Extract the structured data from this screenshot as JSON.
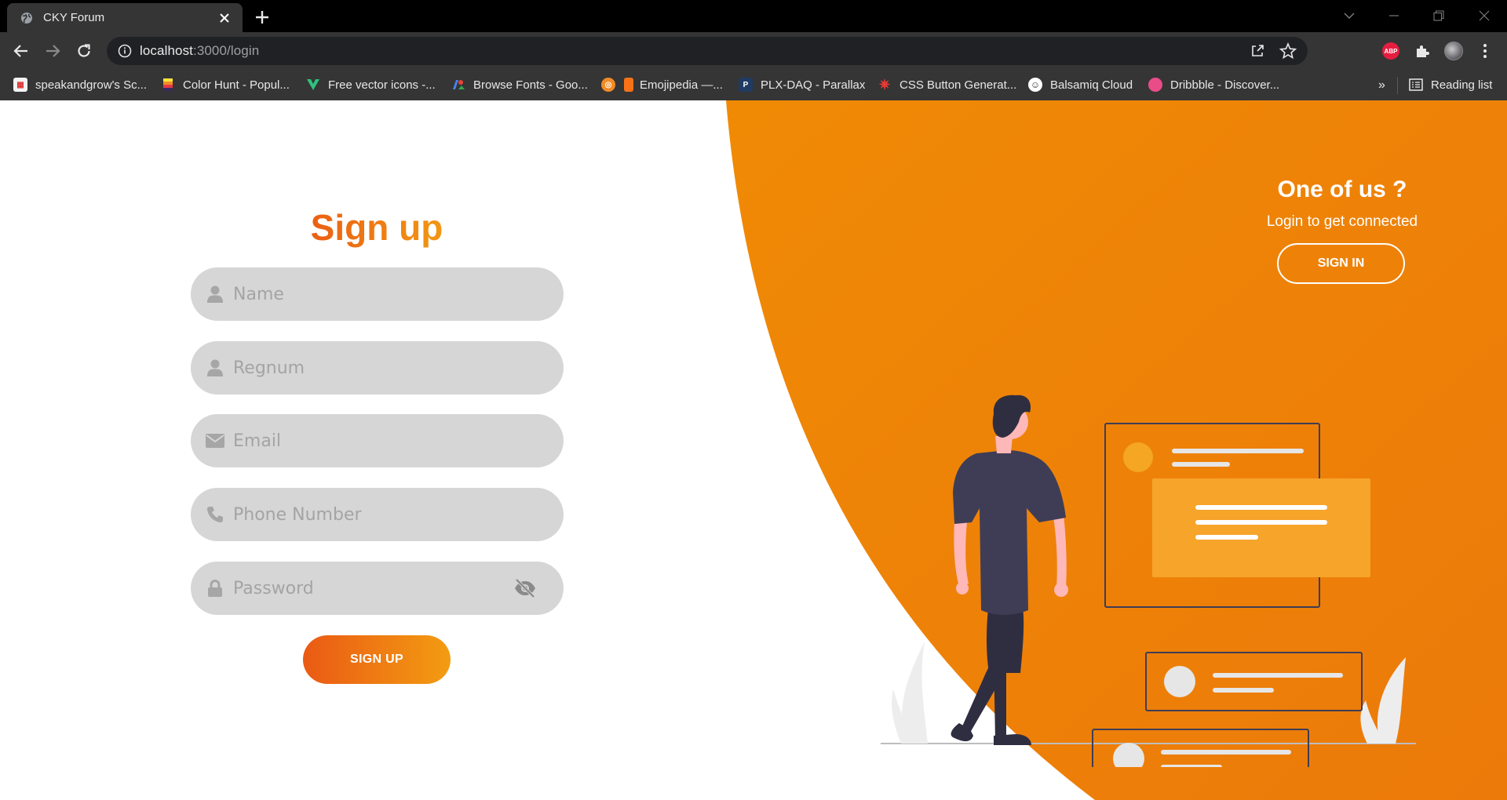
{
  "browser": {
    "tab_title": "CKY Forum",
    "url_host": "localhost",
    "url_rest": ":3000/login",
    "bookmarks": [
      {
        "label": "speakandgrow's Sc...",
        "color": "#f3f3f3"
      },
      {
        "label": "Color Hunt - Popul...",
        "color": "#f0c419"
      },
      {
        "label": "Free vector icons -...",
        "color": "#2ec27e"
      },
      {
        "label": "Browse Fonts - Goo...",
        "color": "#4285f4"
      },
      {
        "label": "",
        "color": "#f28b25"
      },
      {
        "label": "Emojipedia —...",
        "color": "#f97316"
      },
      {
        "label": "PLX-DAQ - Parallax",
        "color": "#1f3b63"
      },
      {
        "label": "CSS Button Generat...",
        "color": "#e53935"
      },
      {
        "label": "Balsamiq Cloud",
        "color": "#ffffff"
      },
      {
        "label": "Dribbble - Discover...",
        "color": "#ea4c89"
      }
    ],
    "more_label": "»",
    "reading_list": "Reading list",
    "extension_abp": "ABP"
  },
  "signup": {
    "title": "Sign up",
    "fields": [
      {
        "icon": "user-icon",
        "placeholder": "Name"
      },
      {
        "icon": "user-icon",
        "placeholder": "Regnum"
      },
      {
        "icon": "envelope-icon",
        "placeholder": "Email"
      },
      {
        "icon": "phone-icon",
        "placeholder": "Phone Number"
      },
      {
        "icon": "lock-icon",
        "placeholder": "Password"
      }
    ],
    "button": "SIGN UP"
  },
  "signin_panel": {
    "heading": "One of us ?",
    "message": "Login to get connected",
    "button": "SIGN IN"
  },
  "colors": {
    "accent_start": "#ea5a14",
    "accent_end": "#f39c12",
    "panel_orange": "#ef8509",
    "field_bg": "#d6d6d6"
  }
}
